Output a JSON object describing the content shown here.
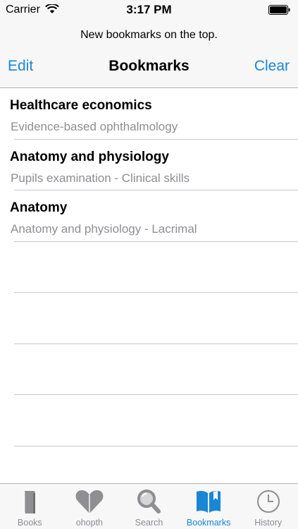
{
  "status": {
    "carrier": "Carrier",
    "time": "3:17 PM"
  },
  "header": {
    "prompt": "New bookmarks on the top.",
    "edit_label": "Edit",
    "title": "Bookmarks",
    "clear_label": "Clear"
  },
  "bookmarks": [
    {
      "title": "Healthcare economics",
      "subtitle": "Evidence-based ophthalmology"
    },
    {
      "title": "Anatomy and physiology",
      "subtitle": "Pupils examination - Clinical skills"
    },
    {
      "title": "Anatomy",
      "subtitle": "Anatomy and physiology - Lacrimal"
    },
    {
      "title": "",
      "subtitle": ""
    },
    {
      "title": "",
      "subtitle": ""
    },
    {
      "title": "",
      "subtitle": ""
    },
    {
      "title": "",
      "subtitle": ""
    }
  ],
  "tabs": [
    {
      "label": "Books",
      "icon": "book-icon"
    },
    {
      "label": "ohopth",
      "icon": "heart-icon"
    },
    {
      "label": "Search",
      "icon": "search-icon"
    },
    {
      "label": "Bookmarks",
      "icon": "bookmarks-icon",
      "active": true
    },
    {
      "label": "History",
      "icon": "clock-icon"
    }
  ],
  "colors": {
    "accent": "#1a86d6",
    "inactive": "#8e8e93",
    "bar_background": "#f7f7f7"
  }
}
